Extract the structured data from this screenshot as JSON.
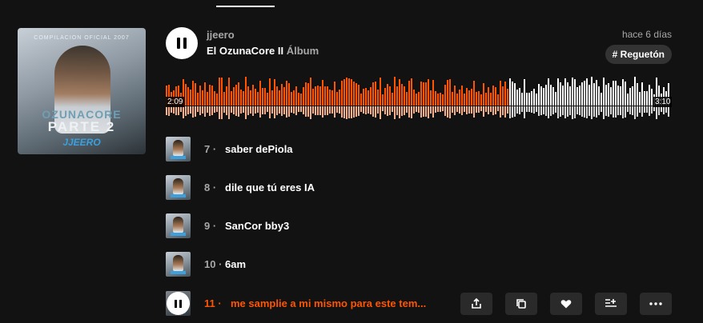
{
  "player": {
    "artist": "jjeero",
    "album_title": "El OzunaCore II",
    "album_kind": "Álbum",
    "posted": "hace 6 días",
    "tag": "# Reguetón",
    "elapsed": "2:09",
    "duration": "3:10",
    "progress": 0.68,
    "play_state_icon": "pause-icon"
  },
  "cover": {
    "top_text": "COMPILACION OFICIAL 2007",
    "line1": "OZUNACORE",
    "line2": "PARTE 2",
    "line3": "JJEERO"
  },
  "tracks": [
    {
      "num": "7 ·",
      "title": "saber dePiola"
    },
    {
      "num": "8 ·",
      "title": "dile que tú eres IA"
    },
    {
      "num": "9 ·",
      "title": "SanCor bby3"
    },
    {
      "num": "10 ·",
      "title": "6am"
    },
    {
      "num": "11 ·",
      "title": "me samplie a mi mismo para este tem...",
      "active": true
    }
  ],
  "actions": [
    "share-icon",
    "copy-icon",
    "heart-icon",
    "add-to-queue-icon",
    "more-icon"
  ],
  "colors": {
    "accent": "#ff5500",
    "background": "#121212",
    "button": "#2a2a2a"
  }
}
